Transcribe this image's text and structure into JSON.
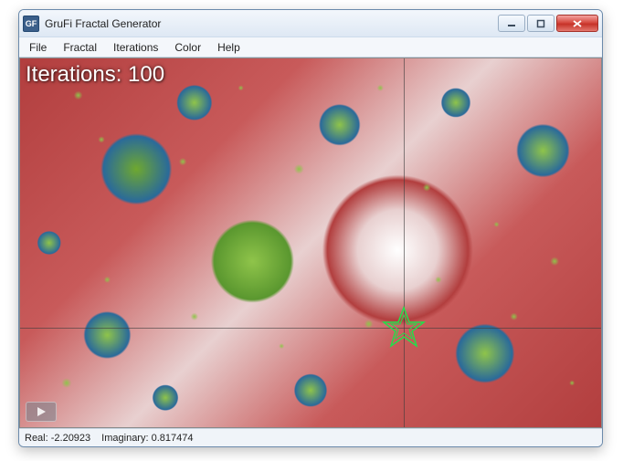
{
  "window": {
    "title": "GruFi Fractal Generator",
    "icon_text": "GF"
  },
  "menubar": {
    "items": [
      "File",
      "Fractal",
      "Iterations",
      "Color",
      "Help"
    ]
  },
  "overlay": {
    "iterations_label": "Iterations: 100"
  },
  "statusbar": {
    "real_label": "Real: -2.20923",
    "imaginary_label": "Imaginary: 0.817474"
  },
  "coords": {
    "real": -2.20923,
    "imaginary": 0.817474,
    "iterations": 100
  }
}
